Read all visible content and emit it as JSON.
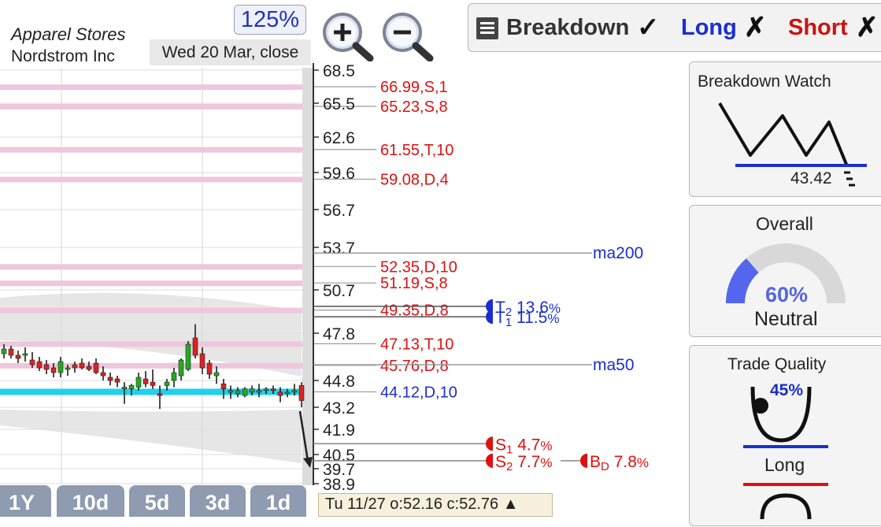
{
  "header": {
    "industry": "Apparel Stores",
    "company": "Nordstrom Inc",
    "zoom": "125%",
    "date": "Wed 20 Mar, close"
  },
  "toolbar": {
    "breakdown_label": "Breakdown",
    "breakdown_mark": "✓",
    "long_label": "Long",
    "long_mark": "✗",
    "short_label": "Short",
    "short_mark": "✗"
  },
  "panels": {
    "breakdown_watch": {
      "title": "Breakdown Watch",
      "value": "43.42"
    },
    "overall": {
      "title": "Overall",
      "percent_label": "60%",
      "percent": 60,
      "rating": "Neutral"
    },
    "trade_quality": {
      "title": "Trade Quality",
      "percent_label": "45%",
      "direction": "Long"
    }
  },
  "periods": [
    "1Y",
    "10d",
    "5d",
    "3d",
    "1d"
  ],
  "quote": "Tu 11/27  o:52.16 c:52.76 ▲",
  "colors": {
    "resistance": "#dd1111",
    "support_blue": "#1a2ed0",
    "band": "#f0c6dc",
    "support_band": "#22d0ee",
    "up_candle": "#22aa22",
    "down_candle": "#dd2222"
  },
  "chart_data": {
    "type": "candlestick",
    "ylim": [
      38.9,
      68.5
    ],
    "y_ticks": [
      "68.5",
      "65.5",
      "62.6",
      "59.6",
      "56.7",
      "53.7",
      "50.7",
      "47.8",
      "44.8",
      "43.2",
      "41.9",
      "40.5",
      "39.7",
      "38.9"
    ],
    "y_tick_values": [
      68.5,
      65.5,
      62.6,
      59.6,
      56.7,
      53.7,
      50.7,
      47.8,
      44.8,
      43.2,
      41.9,
      40.5,
      39.7,
      38.9
    ],
    "levels": [
      {
        "label": "66.99,S,1",
        "value": 66.99
      },
      {
        "label": "65.23,S,8",
        "value": 65.23
      },
      {
        "label": "61.55,T,10",
        "value": 61.55
      },
      {
        "label": "59.08,D,4",
        "value": 59.08
      },
      {
        "label": "52.35,D,10",
        "value": 52.35
      },
      {
        "label": "51.19,S,8",
        "value": 51.19
      },
      {
        "label": "49.35,D,8",
        "value": 49.35
      },
      {
        "label": "47.13,T,10",
        "value": 47.13
      },
      {
        "label": "45.76,D,8",
        "value": 45.76
      },
      {
        "label": "44.12,D,10",
        "value": 44.12,
        "color": "blue"
      }
    ],
    "moving_averages": [
      {
        "name": "ma200",
        "value": 53.3
      },
      {
        "name": "ma50",
        "value": 45.8
      }
    ],
    "targets": [
      {
        "sym": "T",
        "sub": "2",
        "pct": "13.6",
        "value": 49.6
      },
      {
        "sym": "T",
        "sub": "1",
        "pct": "11.5",
        "value": 48.9
      }
    ],
    "stops": [
      {
        "sym": "S",
        "sub": "1",
        "pct": "4.7",
        "value": 41.1
      },
      {
        "sym": "S",
        "sub": "2",
        "pct": "7.7",
        "value": 40.15
      }
    ],
    "breakdown_target": {
      "sym": "B",
      "sub": "D",
      "pct": "7.8",
      "value": 40.15
    },
    "candles": [
      [
        46.5,
        47.1,
        46.2,
        46.8
      ],
      [
        46.8,
        47.0,
        46.2,
        46.4
      ],
      [
        46.4,
        46.7,
        45.9,
        46.2
      ],
      [
        46.4,
        46.9,
        46.0,
        46.5
      ],
      [
        46.1,
        46.6,
        45.6,
        45.8
      ],
      [
        46.0,
        46.3,
        45.4,
        45.6
      ],
      [
        45.8,
        46.1,
        45.2,
        45.5
      ],
      [
        45.6,
        45.9,
        45.0,
        45.3
      ],
      [
        45.3,
        46.3,
        45.0,
        46.0
      ],
      [
        45.5,
        45.8,
        45.1,
        45.6
      ],
      [
        45.8,
        46.0,
        45.3,
        45.6
      ],
      [
        45.9,
        46.2,
        45.5,
        45.6
      ],
      [
        45.7,
        46.0,
        45.4,
        45.5
      ],
      [
        45.9,
        46.2,
        45.2,
        45.3
      ],
      [
        45.3,
        45.7,
        44.8,
        45.1
      ],
      [
        45.0,
        45.3,
        44.5,
        44.8
      ],
      [
        44.9,
        45.1,
        44.4,
        44.7
      ],
      [
        44.3,
        44.7,
        43.4,
        44.4
      ],
      [
        44.3,
        44.6,
        43.9,
        44.5
      ],
      [
        44.4,
        45.3,
        44.2,
        45.0
      ],
      [
        44.9,
        45.4,
        44.4,
        44.6
      ],
      [
        44.7,
        45.5,
        44.3,
        44.5
      ],
      [
        44.0,
        44.5,
        43.1,
        43.9
      ],
      [
        44.5,
        44.9,
        44.2,
        44.7
      ],
      [
        44.8,
        45.6,
        44.4,
        45.3
      ],
      [
        45.1,
        46.2,
        44.8,
        46.1
      ],
      [
        45.5,
        47.3,
        45.4,
        47.1
      ],
      [
        47.5,
        48.4,
        46.2,
        46.4
      ],
      [
        46.5,
        46.9,
        45.2,
        45.6
      ],
      [
        45.9,
        46.1,
        44.9,
        45.2
      ],
      [
        45.1,
        45.7,
        44.6,
        45.3
      ],
      [
        44.6,
        44.9,
        43.7,
        44.3
      ],
      [
        44.1,
        44.5,
        43.7,
        44.2
      ],
      [
        44.0,
        44.4,
        43.8,
        44.2
      ],
      [
        43.9,
        44.4,
        43.8,
        44.3
      ],
      [
        44.1,
        44.5,
        43.9,
        44.3
      ],
      [
        44.1,
        44.6,
        43.8,
        44.2
      ],
      [
        44.2,
        44.4,
        44.0,
        44.3
      ],
      [
        44.3,
        44.5,
        44.0,
        44.2
      ],
      [
        44.1,
        44.4,
        43.5,
        43.9
      ],
      [
        44.0,
        44.3,
        43.8,
        44.1
      ],
      [
        44.2,
        44.6,
        43.9,
        44.2
      ],
      [
        44.5,
        44.7,
        43.2,
        43.6
      ]
    ]
  }
}
